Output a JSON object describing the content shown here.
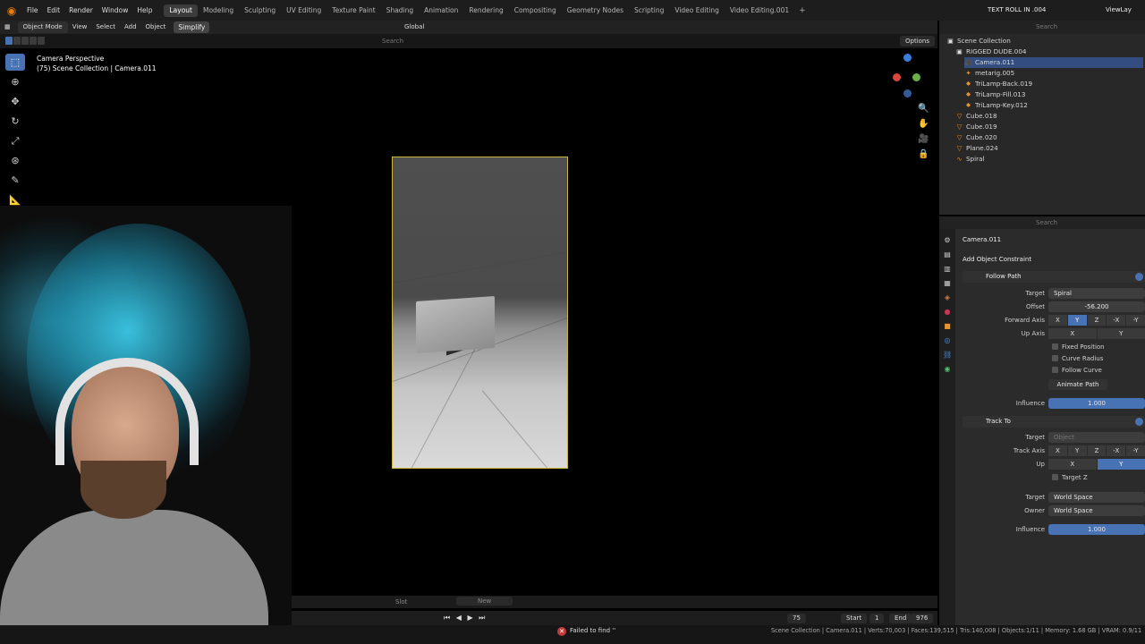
{
  "menubar": {
    "items": [
      "File",
      "Edit",
      "Render",
      "Window",
      "Help"
    ],
    "workspaces": [
      "Layout",
      "Modeling",
      "Sculpting",
      "UV Editing",
      "Texture Paint",
      "Shading",
      "Animation",
      "Rendering",
      "Compositing",
      "Geometry Nodes",
      "Scripting",
      "Video Editing",
      "Video Editing.001"
    ],
    "active_workspace": "Layout",
    "scene": "TEXT ROLL IN .004",
    "view_layer": "ViewLay"
  },
  "viewport_header": {
    "mode": "Object Mode",
    "menus": [
      "View",
      "Select",
      "Add",
      "Object"
    ],
    "simplify": "Simplify",
    "orientation": "Global",
    "search_placeholder": "Search",
    "options": "Options"
  },
  "viewport": {
    "title": "Camera Perspective",
    "subtitle": "(75) Scene Collection | Camera.011"
  },
  "timeline": {
    "slot": "Slot",
    "new_label": "New",
    "current_frame": "75",
    "start_label": "Start",
    "start": "1",
    "end_label": "End",
    "end": "976"
  },
  "status": {
    "error": "Failed to find ''",
    "info": "Scene Collection | Camera.011 | Verts:70,003 | Faces:139,515 | Tris:140,008 | Objects:1/11 | Memory: 1.68 GB | VRAM: 0.9/11"
  },
  "outliner": {
    "search_placeholder": "Search",
    "items": [
      {
        "label": "Scene Collection",
        "indent": 0,
        "selected": false,
        "icon": "collection-icon"
      },
      {
        "label": "RIGGED DUDE.004",
        "indent": 1,
        "selected": false,
        "icon": "collection-icon"
      },
      {
        "label": "Camera.011",
        "indent": 2,
        "selected": true,
        "icon": "camera-icon"
      },
      {
        "label": "metarig.005",
        "indent": 2,
        "selected": false,
        "icon": "armature-icon"
      },
      {
        "label": "TriLamp-Back.019",
        "indent": 2,
        "selected": false,
        "icon": "light-icon"
      },
      {
        "label": "TriLamp-Fill.013",
        "indent": 2,
        "selected": false,
        "icon": "light-icon"
      },
      {
        "label": "TriLamp-Key.012",
        "indent": 2,
        "selected": false,
        "icon": "light-icon"
      },
      {
        "label": "Cube.018",
        "indent": 1,
        "selected": false,
        "icon": "mesh-icon"
      },
      {
        "label": "Cube.019",
        "indent": 1,
        "selected": false,
        "icon": "mesh-icon"
      },
      {
        "label": "Cube.020",
        "indent": 1,
        "selected": false,
        "icon": "mesh-icon"
      },
      {
        "label": "Plane.024",
        "indent": 1,
        "selected": false,
        "icon": "mesh-icon"
      },
      {
        "label": "Spiral",
        "indent": 1,
        "selected": false,
        "icon": "curve-icon"
      }
    ]
  },
  "properties": {
    "search_placeholder": "Search",
    "object_name": "Camera.011",
    "add_constraint": "Add Object Constraint",
    "follow_path": {
      "name": "Follow Path",
      "target_label": "Target",
      "target": "Spiral",
      "offset_label": "Offset",
      "offset": "-56.200",
      "forward_axis_label": "Forward Axis",
      "forward_axes": [
        "X",
        "Y",
        "Z",
        "-X",
        "-Y"
      ],
      "forward_selected": "Y",
      "up_axis_label": "Up Axis",
      "up_axes": [
        "X",
        "Y"
      ],
      "fixed_position": "Fixed Position",
      "curve_radius": "Curve Radius",
      "follow_curve": "Follow Curve",
      "animate_path": "Animate Path",
      "influence_label": "Influence",
      "influence": "1.000"
    },
    "track_to": {
      "name": "Track To",
      "target_label": "Target",
      "target_placeholder": "Object",
      "track_axis_label": "Track Axis",
      "track_axes": [
        "X",
        "Y",
        "Z",
        "-X",
        "-Y"
      ],
      "up_label": "Up",
      "up_axes": [
        "X",
        "Y"
      ],
      "up_selected": "Y",
      "target_z": "Target Z",
      "space_target_label": "Target",
      "space_target": "World Space",
      "owner_label": "Owner",
      "owner": "World Space",
      "influence_label": "Influence",
      "influence": "1.000"
    }
  },
  "colors": {
    "accent": "#4772b3",
    "camera_frame": "#c8b83c",
    "error": "#c23a3a",
    "blender_orange": "#e87d0d"
  }
}
